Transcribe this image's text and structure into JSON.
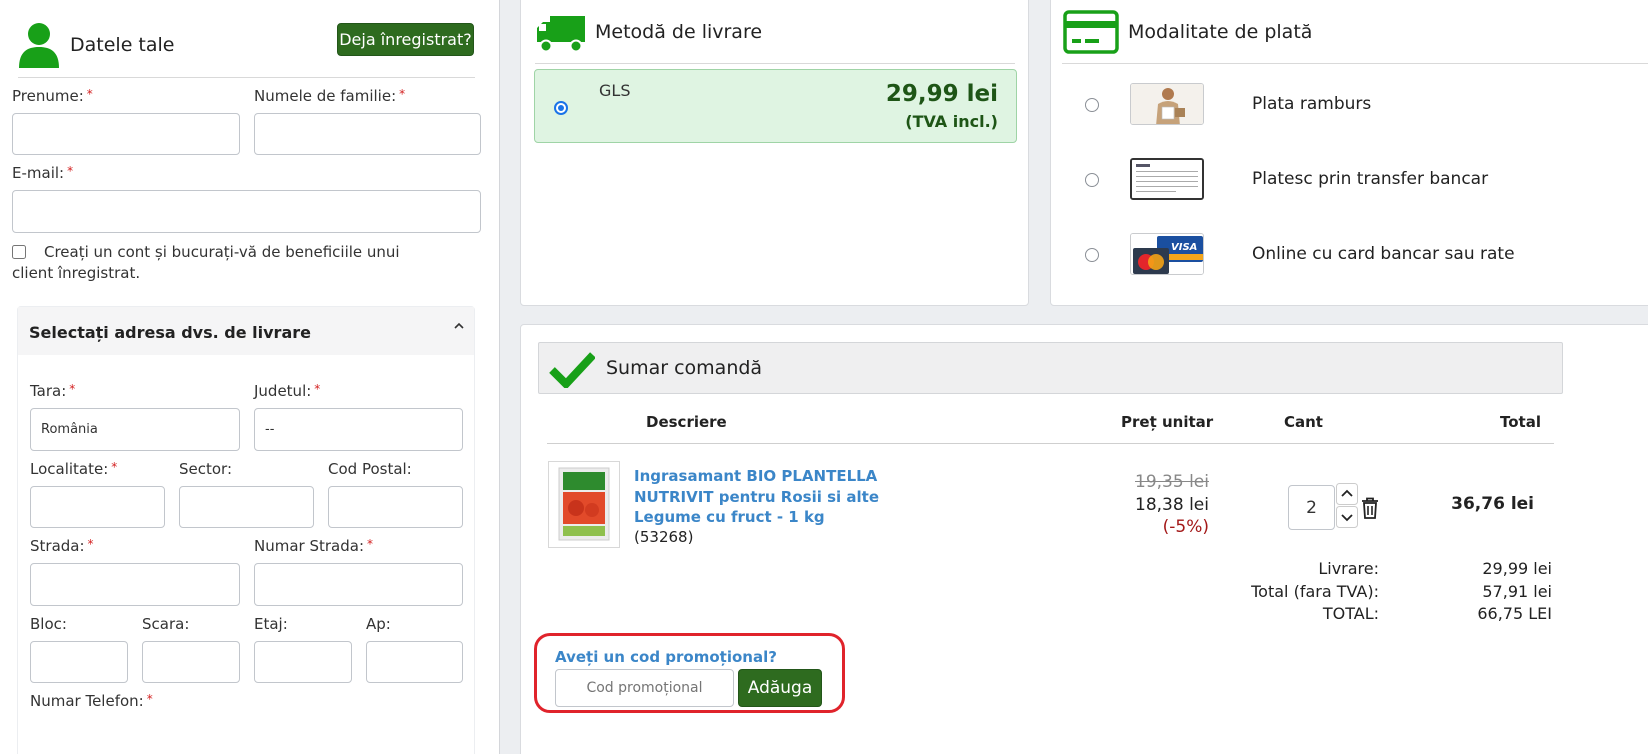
{
  "personal": {
    "title": "Datele tale",
    "already_registered_button": "Deja înregistrat?",
    "first_name_label": "Prenume:",
    "last_name_label": "Numele de familie:",
    "email_label": "E-mail:",
    "create_account_text": "Creați un cont și bucurați-vă de beneficiile unui client înregistrat.",
    "required_mark": "*"
  },
  "address": {
    "title": "Selectați adresa dvs. de livrare",
    "country_label": "Tara:",
    "country_value": "România",
    "county_label": "Judetul:",
    "county_value": "--",
    "city_label": "Localitate:",
    "sector_label": "Sector:",
    "postal_label": "Cod Postal:",
    "street_label": "Strada:",
    "street_number_label": "Numar Strada:",
    "block_label": "Bloc:",
    "staircase_label": "Scara:",
    "floor_label": "Etaj:",
    "apartment_label": "Ap:",
    "phone_label": "Numar Telefon:"
  },
  "delivery": {
    "title": "Metodă de livrare",
    "option_name": "GLS",
    "option_price": "29,99 lei",
    "option_vat": "(TVA incl.)",
    "selected": true
  },
  "payment": {
    "title": "Modalitate de plată",
    "options": [
      {
        "label": "Plata ramburs",
        "icon": "cash-on-delivery-image"
      },
      {
        "label": "Platesc prin transfer bancar",
        "icon": "bank-transfer-image"
      },
      {
        "label": "Online cu card bancar sau rate",
        "icon": "card-visa-mastercard-image"
      }
    ]
  },
  "summary": {
    "title": "Sumar comandă",
    "columns": {
      "description": "Descriere",
      "unit_price": "Preț unitar",
      "quantity": "Cant",
      "total": "Total"
    },
    "item": {
      "name": "Ingrasamant BIO PLANTELLA NUTRIVIT pentru Rosii si alte Legume cu fruct - 1 kg",
      "code": "(53268)",
      "old_price": "19,35 lei",
      "price": "18,38 lei",
      "discount": "(-5%)",
      "quantity": "2",
      "total": "36,76 lei"
    },
    "totals": [
      {
        "label": "Livrare:",
        "value": "29,99 lei"
      },
      {
        "label": "Total (fara TVA):",
        "value": "57,91 lei"
      },
      {
        "label": "TOTAL:",
        "value": "66,75 LEI"
      }
    ],
    "promo_question": "Aveți un cod promoțional?",
    "promo_placeholder": "Cod promoțional",
    "promo_button": "Adăuga"
  },
  "colors": {
    "brand_green": "#2e6b1f",
    "icon_green": "#18a018",
    "link_blue": "#3b86c8",
    "highlight_red": "#e0232b"
  }
}
